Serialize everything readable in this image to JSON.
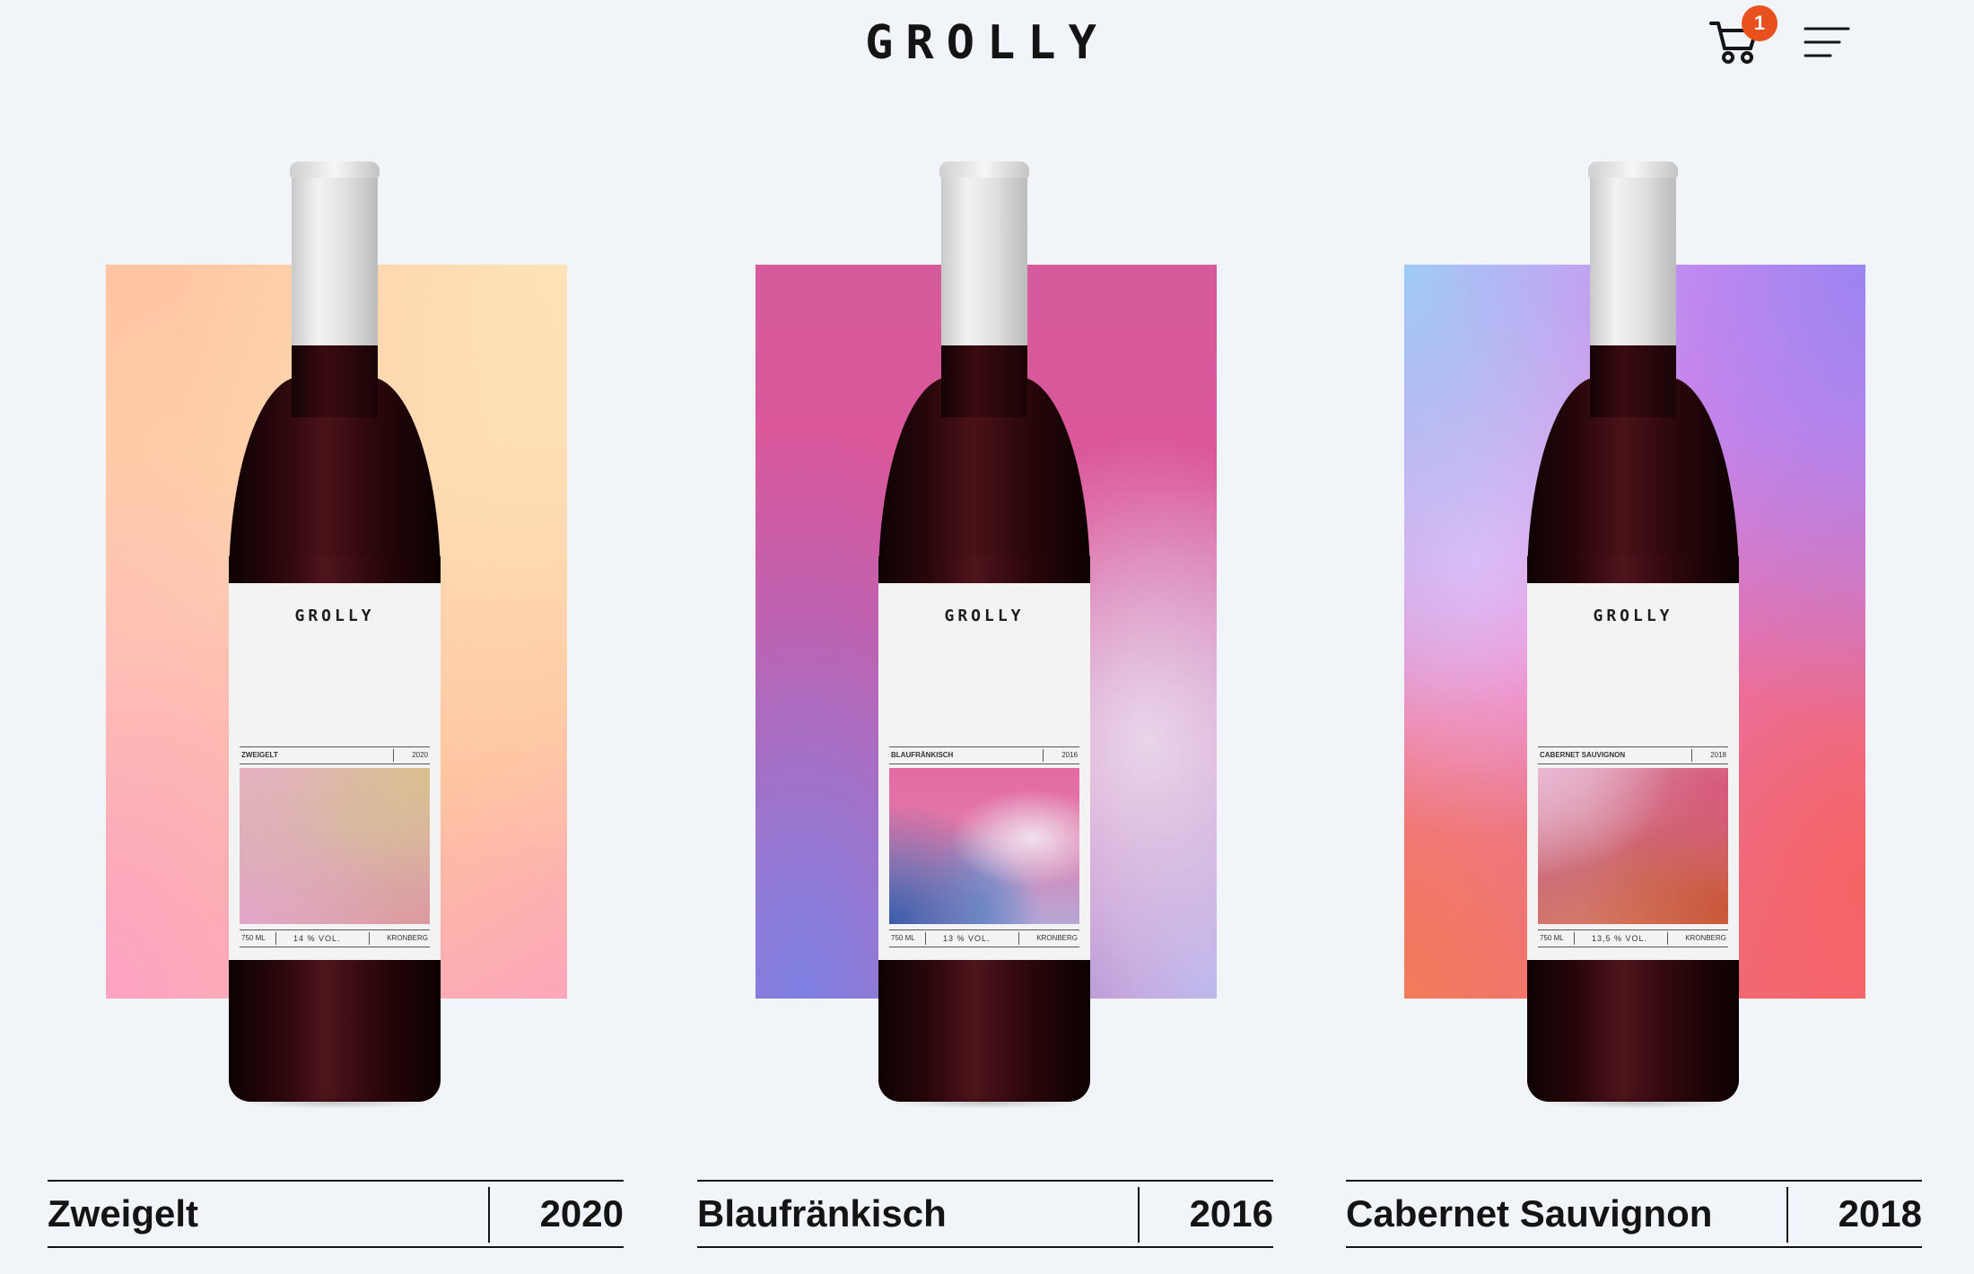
{
  "header": {
    "brand": "GROLLY",
    "cart_count": "1",
    "icons": {
      "cart": "cart-icon",
      "menu": "hamburger-menu-icon"
    },
    "accent_color": "#e8501e"
  },
  "products": [
    {
      "name": "Zweigelt",
      "year": "2020",
      "label": {
        "brand": "GROLLY",
        "name": "ZWEIGELT",
        "year": "2020",
        "volume": "750 ML",
        "alcohol": "14 % VOL.",
        "origin": "KRONBERG"
      }
    },
    {
      "name": "Blaufränkisch",
      "year": "2016",
      "label": {
        "brand": "GROLLY",
        "name": "BLAUFRÄNKISCH",
        "year": "2016",
        "volume": "750 ML",
        "alcohol": "13 % VOL.",
        "origin": "KRONBERG"
      }
    },
    {
      "name": "Cabernet Sauvignon",
      "year": "2018",
      "label": {
        "brand": "GROLLY",
        "name": "CABERNET SAUVIGNON",
        "year": "2018",
        "volume": "750 ML",
        "alcohol": "13,5 % VOL.",
        "origin": "KRONBERG"
      }
    }
  ]
}
